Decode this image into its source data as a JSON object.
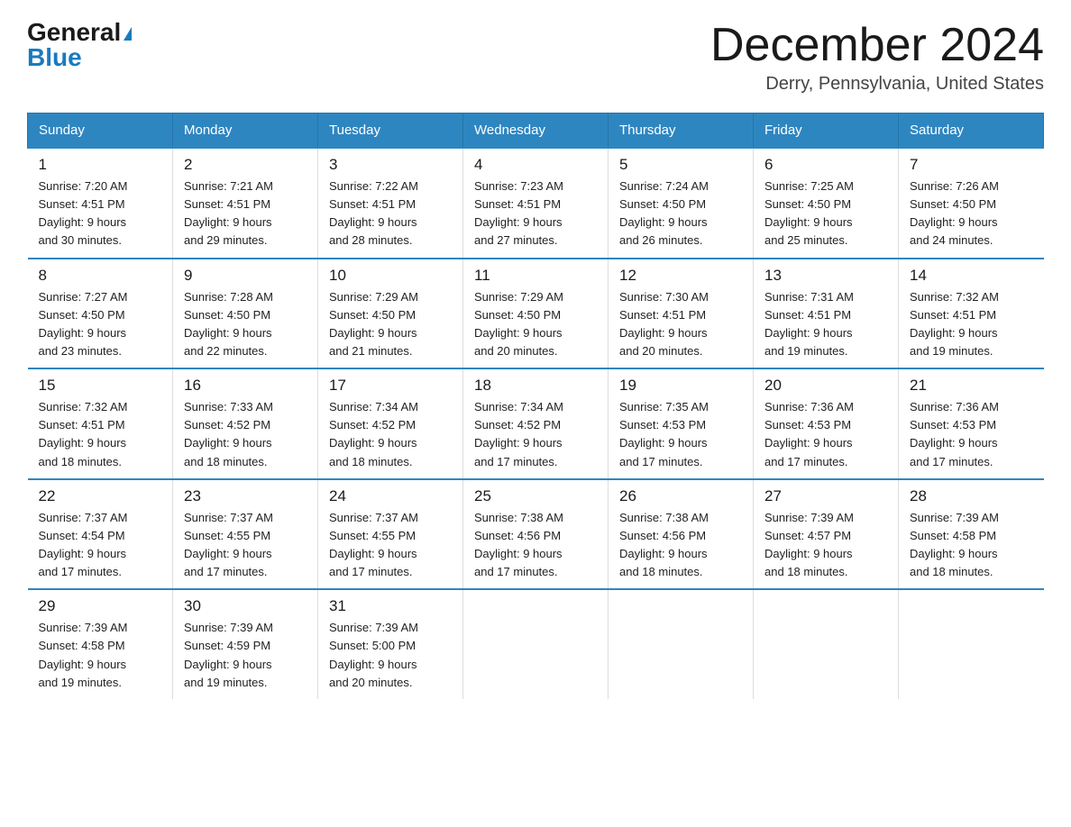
{
  "logo": {
    "general": "General",
    "blue": "Blue"
  },
  "title": "December 2024",
  "subtitle": "Derry, Pennsylvania, United States",
  "days_of_week": [
    "Sunday",
    "Monday",
    "Tuesday",
    "Wednesday",
    "Thursday",
    "Friday",
    "Saturday"
  ],
  "weeks": [
    [
      {
        "day": "1",
        "sunrise": "7:20 AM",
        "sunset": "4:51 PM",
        "daylight": "9 hours and 30 minutes."
      },
      {
        "day": "2",
        "sunrise": "7:21 AM",
        "sunset": "4:51 PM",
        "daylight": "9 hours and 29 minutes."
      },
      {
        "day": "3",
        "sunrise": "7:22 AM",
        "sunset": "4:51 PM",
        "daylight": "9 hours and 28 minutes."
      },
      {
        "day": "4",
        "sunrise": "7:23 AM",
        "sunset": "4:51 PM",
        "daylight": "9 hours and 27 minutes."
      },
      {
        "day": "5",
        "sunrise": "7:24 AM",
        "sunset": "4:50 PM",
        "daylight": "9 hours and 26 minutes."
      },
      {
        "day": "6",
        "sunrise": "7:25 AM",
        "sunset": "4:50 PM",
        "daylight": "9 hours and 25 minutes."
      },
      {
        "day": "7",
        "sunrise": "7:26 AM",
        "sunset": "4:50 PM",
        "daylight": "9 hours and 24 minutes."
      }
    ],
    [
      {
        "day": "8",
        "sunrise": "7:27 AM",
        "sunset": "4:50 PM",
        "daylight": "9 hours and 23 minutes."
      },
      {
        "day": "9",
        "sunrise": "7:28 AM",
        "sunset": "4:50 PM",
        "daylight": "9 hours and 22 minutes."
      },
      {
        "day": "10",
        "sunrise": "7:29 AM",
        "sunset": "4:50 PM",
        "daylight": "9 hours and 21 minutes."
      },
      {
        "day": "11",
        "sunrise": "7:29 AM",
        "sunset": "4:50 PM",
        "daylight": "9 hours and 20 minutes."
      },
      {
        "day": "12",
        "sunrise": "7:30 AM",
        "sunset": "4:51 PM",
        "daylight": "9 hours and 20 minutes."
      },
      {
        "day": "13",
        "sunrise": "7:31 AM",
        "sunset": "4:51 PM",
        "daylight": "9 hours and 19 minutes."
      },
      {
        "day": "14",
        "sunrise": "7:32 AM",
        "sunset": "4:51 PM",
        "daylight": "9 hours and 19 minutes."
      }
    ],
    [
      {
        "day": "15",
        "sunrise": "7:32 AM",
        "sunset": "4:51 PM",
        "daylight": "9 hours and 18 minutes."
      },
      {
        "day": "16",
        "sunrise": "7:33 AM",
        "sunset": "4:52 PM",
        "daylight": "9 hours and 18 minutes."
      },
      {
        "day": "17",
        "sunrise": "7:34 AM",
        "sunset": "4:52 PM",
        "daylight": "9 hours and 18 minutes."
      },
      {
        "day": "18",
        "sunrise": "7:34 AM",
        "sunset": "4:52 PM",
        "daylight": "9 hours and 17 minutes."
      },
      {
        "day": "19",
        "sunrise": "7:35 AM",
        "sunset": "4:53 PM",
        "daylight": "9 hours and 17 minutes."
      },
      {
        "day": "20",
        "sunrise": "7:36 AM",
        "sunset": "4:53 PM",
        "daylight": "9 hours and 17 minutes."
      },
      {
        "day": "21",
        "sunrise": "7:36 AM",
        "sunset": "4:53 PM",
        "daylight": "9 hours and 17 minutes."
      }
    ],
    [
      {
        "day": "22",
        "sunrise": "7:37 AM",
        "sunset": "4:54 PM",
        "daylight": "9 hours and 17 minutes."
      },
      {
        "day": "23",
        "sunrise": "7:37 AM",
        "sunset": "4:55 PM",
        "daylight": "9 hours and 17 minutes."
      },
      {
        "day": "24",
        "sunrise": "7:37 AM",
        "sunset": "4:55 PM",
        "daylight": "9 hours and 17 minutes."
      },
      {
        "day": "25",
        "sunrise": "7:38 AM",
        "sunset": "4:56 PM",
        "daylight": "9 hours and 17 minutes."
      },
      {
        "day": "26",
        "sunrise": "7:38 AM",
        "sunset": "4:56 PM",
        "daylight": "9 hours and 18 minutes."
      },
      {
        "day": "27",
        "sunrise": "7:39 AM",
        "sunset": "4:57 PM",
        "daylight": "9 hours and 18 minutes."
      },
      {
        "day": "28",
        "sunrise": "7:39 AM",
        "sunset": "4:58 PM",
        "daylight": "9 hours and 18 minutes."
      }
    ],
    [
      {
        "day": "29",
        "sunrise": "7:39 AM",
        "sunset": "4:58 PM",
        "daylight": "9 hours and 19 minutes."
      },
      {
        "day": "30",
        "sunrise": "7:39 AM",
        "sunset": "4:59 PM",
        "daylight": "9 hours and 19 minutes."
      },
      {
        "day": "31",
        "sunrise": "7:39 AM",
        "sunset": "5:00 PM",
        "daylight": "9 hours and 20 minutes."
      },
      null,
      null,
      null,
      null
    ]
  ],
  "labels": {
    "sunrise": "Sunrise:",
    "sunset": "Sunset:",
    "daylight": "Daylight:"
  }
}
